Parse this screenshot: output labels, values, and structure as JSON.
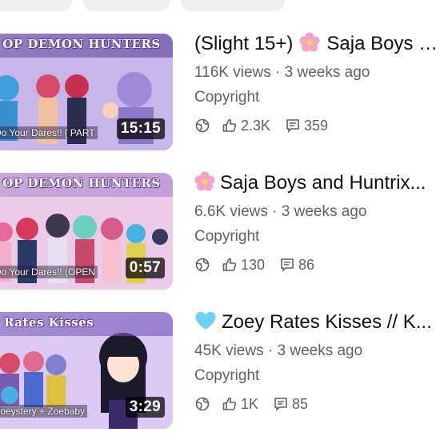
{
  "videos": [
    {
      "title_prefix": "(Slight 15+)",
      "title_text": "Saja Boys and Huntrix play Truth or Dare",
      "title_emoji": "pink-flower",
      "views": "116K views",
      "separator": "·",
      "age": "3 weeks ago",
      "label": "Copyright",
      "likes": "2.3K",
      "comments": "359",
      "thumb_banner": "OP DEMON HUNTERS",
      "thumb_caption": "Do Your Dares!! [ PART",
      "duration": "15:15",
      "colors": {
        "bg": "#c9b8e8",
        "stripe": "#6a4fa0"
      }
    },
    {
      "title_prefix": "",
      "title_text": "Saja Boys and Huntrix...",
      "title_emoji": "pink-flower",
      "views": "6.6K views",
      "separator": "·",
      "age": "3 weeks ago",
      "label": "Copyright",
      "likes": "130",
      "comments": "86",
      "thumb_banner": "OP DEMON HUNTERS",
      "thumb_caption": "Do Your Dares!! (OPEN",
      "duration": "0:57",
      "colors": {
        "bg": "#e8c9ea",
        "stripe": "#b08ad0"
      }
    },
    {
      "title_prefix": "",
      "title_text": "Zoey Rates Kisses // K...",
      "title_emoji": "light-blue-heart",
      "views": "45K views",
      "separator": "·",
      "age": "3 weeks ago",
      "label": "Copyright",
      "likes": "1K",
      "comments": "85",
      "thumb_banner": "y Rates Kisses",
      "thumb_caption": "Zoeystery + Zoebaby",
      "duration": "3:29",
      "colors": {
        "bg": "#d8c6f0",
        "stripe": "#7b5cc0"
      }
    }
  ],
  "icons": {
    "visibility": "globe-icon",
    "like": "thumbs-up-icon",
    "comment": "comment-icon"
  }
}
